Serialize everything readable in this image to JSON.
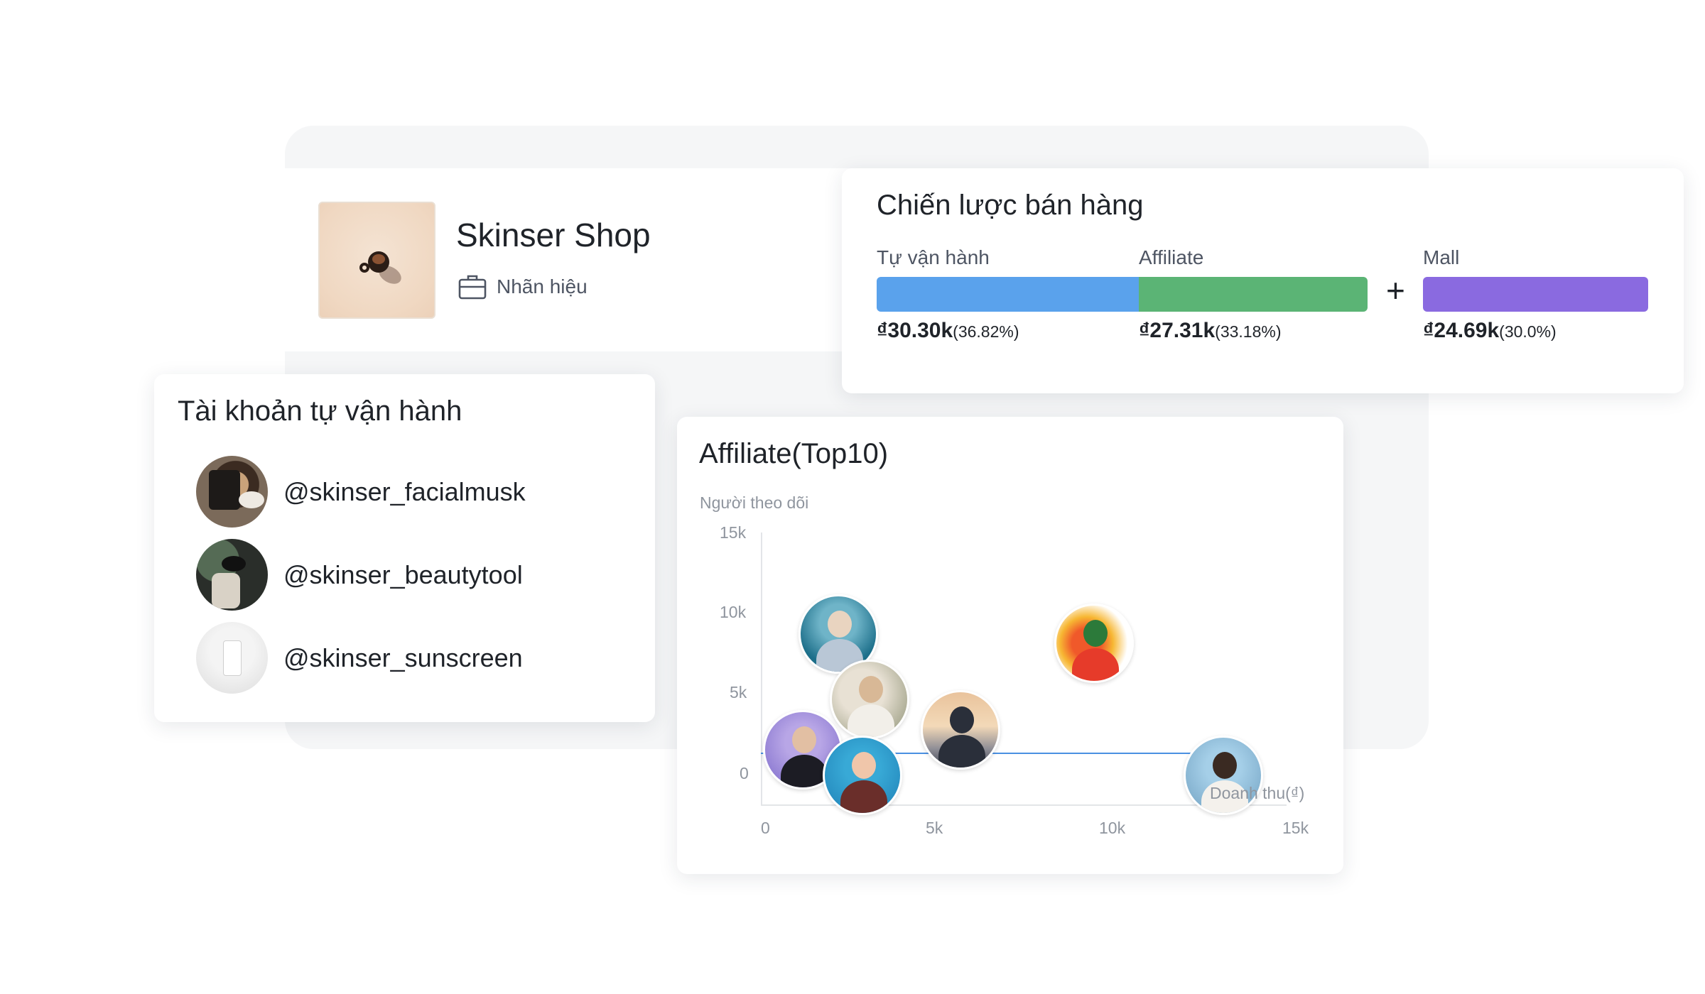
{
  "shop": {
    "name": "Skinser Shop",
    "type_label": "Nhãn hiệu",
    "type_icon": "briefcase-icon"
  },
  "strategy": {
    "title": "Chiến lược bán hàng",
    "segments": [
      {
        "label": "Tự vận hành",
        "value": "₫30.30k",
        "percent": "(36.82%)",
        "color": "#5aa2ec"
      },
      {
        "label": "Affiliate",
        "value": "₫27.31k",
        "percent": "(33.18%)",
        "color": "#5bb475"
      },
      {
        "label": "Mall",
        "value": "₫24.69k",
        "percent": "(30.0%)",
        "color": "#8a6ae0"
      }
    ],
    "plus_symbol": "+"
  },
  "accounts": {
    "title": "Tài khoản tự vận hành",
    "items": [
      {
        "handle": "@skinser_facialmusk"
      },
      {
        "handle": "@skinser_beautytool"
      },
      {
        "handle": "@skinser_sunscreen"
      }
    ]
  },
  "affiliate": {
    "title": "Affiliate(Top10)"
  },
  "chart_data": {
    "type": "scatter",
    "ylabel": "Người theo dõi",
    "xlabel": "Doanh thu(₫)",
    "xlim": [
      0,
      15000
    ],
    "ylim": [
      0,
      15000
    ],
    "x_ticks": [
      "0",
      "5k",
      "10k",
      "15k"
    ],
    "y_ticks": [
      "0",
      "5k",
      "10k",
      "15k"
    ],
    "grid": false,
    "crosshair": {
      "x": 13200,
      "y": 1000
    },
    "points": [
      {
        "x": 2200,
        "y": 9400
      },
      {
        "x": 3100,
        "y": 5800
      },
      {
        "x": 1200,
        "y": 3000
      },
      {
        "x": 2900,
        "y": 1600
      },
      {
        "x": 5700,
        "y": 4100
      },
      {
        "x": 9500,
        "y": 8900
      },
      {
        "x": 13200,
        "y": 1600
      }
    ]
  }
}
